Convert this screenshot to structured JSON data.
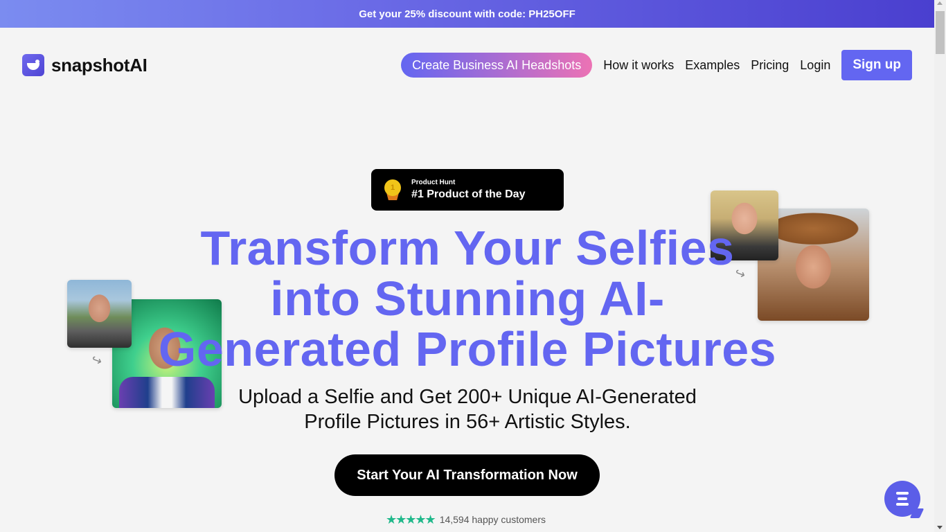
{
  "promo": {
    "text": "Get your 25% discount with code: PH25OFF"
  },
  "header": {
    "logo_text": "snapshotAI",
    "logo_icon": "smile-face-icon",
    "nav": {
      "cta_label": "Create Business AI Headshots",
      "links": [
        "How it works",
        "Examples",
        "Pricing",
        "Login"
      ],
      "signup_label": "Sign up"
    }
  },
  "badge": {
    "icon": "medal-icon",
    "medal_number": "1",
    "source": "Product Hunt",
    "title": "#1 Product of the Day"
  },
  "hero": {
    "title_lines": [
      "Transform Your Selfies",
      "into Stunning AI-",
      "Generated Profile Pictures"
    ],
    "subtitle_lines": [
      "Upload a Selfie and Get 200+ Unique AI-Generated",
      "Profile Pictures in 56+ Artistic Styles."
    ],
    "cta_label": "Start Your AI Transformation Now",
    "rating": {
      "stars": 5,
      "star_glyphs": "★★★★★",
      "text": "14,594 happy customers"
    }
  },
  "examples": [
    {
      "before": "selfie-man",
      "after": "ai-portrait-man-neon"
    },
    {
      "before": "selfie-woman",
      "after": "ai-portrait-woman-cowboy-hat"
    }
  ],
  "arrow_glyph": "↪",
  "chat": {
    "icon": "chat-bubble-icon"
  },
  "colors": {
    "accent": "#6366f1",
    "gradient_pink": "#ec72b4",
    "star_green": "#1fb88a",
    "cta_black": "#000000"
  }
}
